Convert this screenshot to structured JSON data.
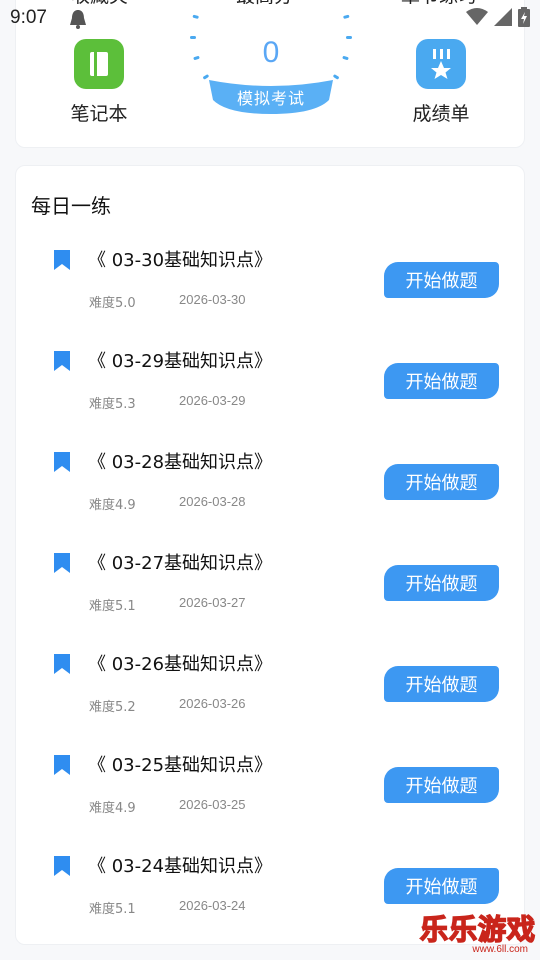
{
  "status_bar": {
    "time": "9:07"
  },
  "top_card": {
    "labels": {
      "left": "收藏夹",
      "center": "最高分",
      "right": "章节练习"
    },
    "score": "0",
    "exam_button": "模拟考试",
    "tiles": {
      "notebook": {
        "label": "笔记本",
        "icon": "notebook-icon",
        "color": "#5cbf3a"
      },
      "report": {
        "label": "成绩单",
        "icon": "medal-icon",
        "color": "#4aa9f0"
      }
    }
  },
  "daily": {
    "title": "每日一练",
    "button_label": "开始做题",
    "items": [
      {
        "title": "《 03-30基础知识点》",
        "difficulty": "难度5.0",
        "date": "2026-03-30"
      },
      {
        "title": "《 03-29基础知识点》",
        "difficulty": "难度5.3",
        "date": "2026-03-29"
      },
      {
        "title": "《 03-28基础知识点》",
        "difficulty": "难度4.9",
        "date": "2026-03-28"
      },
      {
        "title": "《 03-27基础知识点》",
        "difficulty": "难度5.1",
        "date": "2026-03-27"
      },
      {
        "title": "《 03-26基础知识点》",
        "difficulty": "难度5.2",
        "date": "2026-03-26"
      },
      {
        "title": "《 03-25基础知识点》",
        "difficulty": "难度4.9",
        "date": "2026-03-25"
      },
      {
        "title": "《 03-24基础知识点》",
        "difficulty": "难度5.1",
        "date": "2026-03-24"
      }
    ]
  },
  "watermark": {
    "main": "乐乐游戏",
    "sub": "www.6ll.com"
  },
  "colors": {
    "accent": "#3d98f2",
    "gauge": "#4aa9f0",
    "score": "#5aa7f5"
  }
}
